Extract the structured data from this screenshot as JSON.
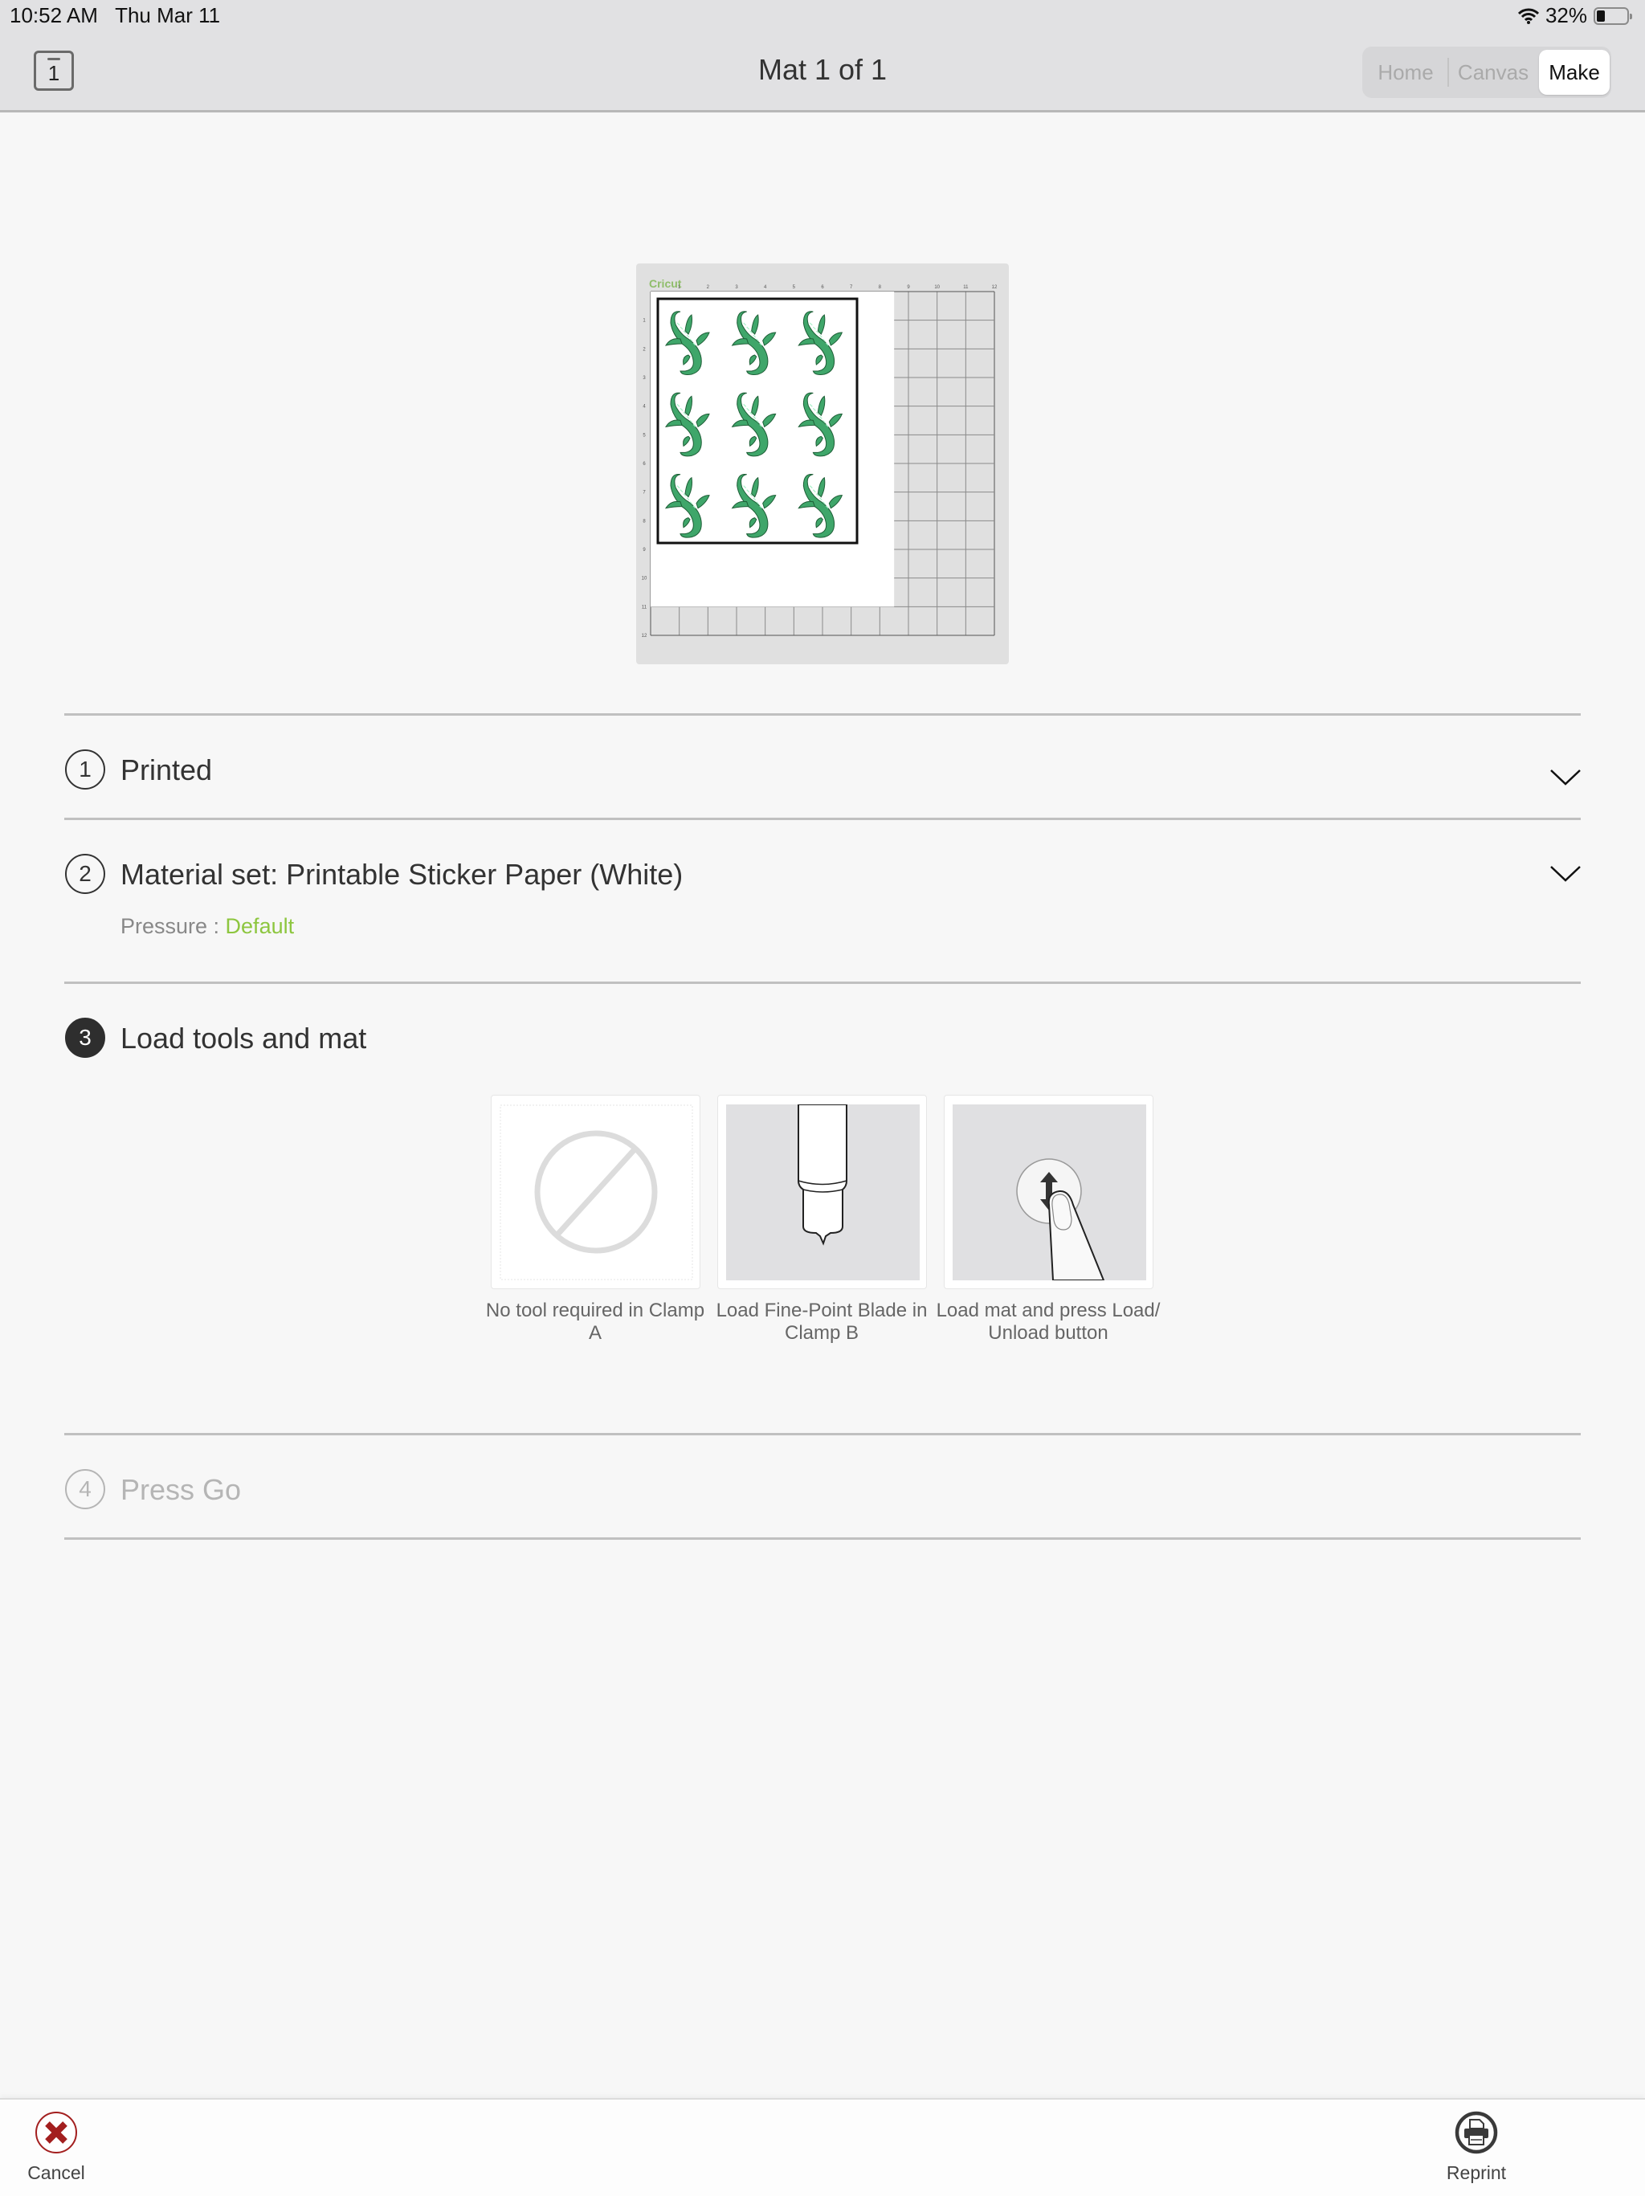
{
  "status_bar": {
    "time": "10:52 AM",
    "date": "Thu Mar 11",
    "battery": "32%",
    "battery_level": 0.32
  },
  "header": {
    "mat_icon_number": "1",
    "title": "Mat 1 of 1",
    "nav": [
      {
        "label": "Home",
        "active": false
      },
      {
        "label": "Canvas",
        "active": false
      },
      {
        "label": "Make",
        "active": true
      }
    ]
  },
  "mat_preview": {
    "brand": "Cricut",
    "mat_size_in": [
      12,
      12
    ],
    "top_ruler": [
      "1",
      "2",
      "3",
      "4",
      "5",
      "6",
      "7",
      "8",
      "9",
      "10",
      "11",
      "12"
    ],
    "side_ruler": [
      "1",
      "2",
      "3",
      "4",
      "5",
      "6",
      "7",
      "8",
      "9",
      "10",
      "11",
      "12"
    ],
    "paper_size_in": [
      8.5,
      11
    ],
    "sticker_grid": {
      "rows": 3,
      "cols": 3
    },
    "sticker_color": "#3fa66a",
    "sticker_highlight": "#a9f0c8"
  },
  "steps": [
    {
      "number": "1",
      "title": "Printed",
      "state": "done",
      "expandable": true
    },
    {
      "number": "2",
      "title": "Material set: Printable Sticker Paper (White)",
      "state": "done",
      "expandable": true,
      "detail_label": "Pressure : ",
      "detail_value": "Default"
    },
    {
      "number": "3",
      "title": "Load tools and mat",
      "state": "active",
      "tools": [
        {
          "icon": "no-tool-icon",
          "caption": "No tool required in Clamp A"
        },
        {
          "icon": "fine-point-blade-icon",
          "caption": "Load Fine-Point Blade in Clamp B"
        },
        {
          "icon": "load-unload-button-icon",
          "caption": "Load mat and press Load/ Unload button"
        }
      ]
    },
    {
      "number": "4",
      "title": "Press Go",
      "state": "disabled"
    }
  ],
  "colors": {
    "accent_green": "#8dc63f",
    "cancel_red": "#a31f1f"
  },
  "bottom_bar": {
    "cancel_label": "Cancel",
    "reprint_label": "Reprint"
  }
}
